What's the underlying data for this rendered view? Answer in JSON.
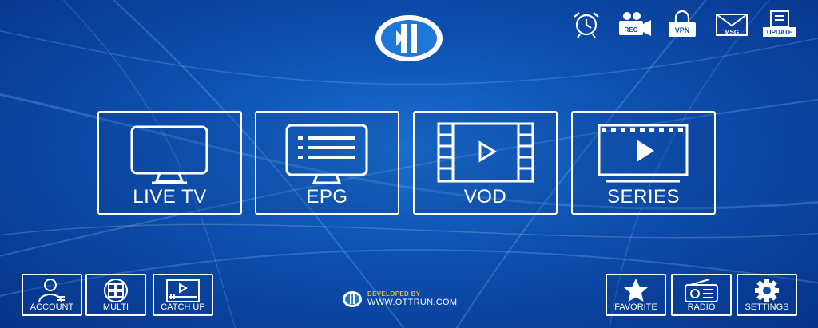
{
  "top_icons": [
    {
      "name": "alarm-clock-icon",
      "label": ""
    },
    {
      "name": "record-camera-icon",
      "label": "REC"
    },
    {
      "name": "vpn-lock-icon",
      "label": "VPN"
    },
    {
      "name": "message-envelope-icon",
      "label": "MSG"
    },
    {
      "name": "update-icon",
      "label": "UPDATE"
    }
  ],
  "main_tiles": [
    {
      "label": "LIVE TV",
      "icon": "tv-icon"
    },
    {
      "label": "EPG",
      "icon": "epg-guide-icon"
    },
    {
      "label": "VOD",
      "icon": "film-strip-icon"
    },
    {
      "label": "SERIES",
      "icon": "series-play-icon"
    }
  ],
  "bottom_left": [
    {
      "label": "ACCOUNT",
      "icon": "account-user-icon"
    },
    {
      "label": "MULTI",
      "icon": "multi-screen-icon"
    },
    {
      "label": "CATCH UP",
      "icon": "catch-up-icon"
    }
  ],
  "bottom_right": [
    {
      "label": "FAVORITE",
      "icon": "star-icon"
    },
    {
      "label": "RADIO",
      "icon": "radio-icon"
    },
    {
      "label": "SETTINGS",
      "icon": "gear-icon"
    }
  ],
  "footer": {
    "developed_by": "DEVELOPED BY",
    "url": "WWW.OTTRUN.COM"
  },
  "colors": {
    "background": "#0d4fae",
    "accent": "#ffb400",
    "logo_blue": "#1e78d8",
    "border": "#ffffff"
  }
}
